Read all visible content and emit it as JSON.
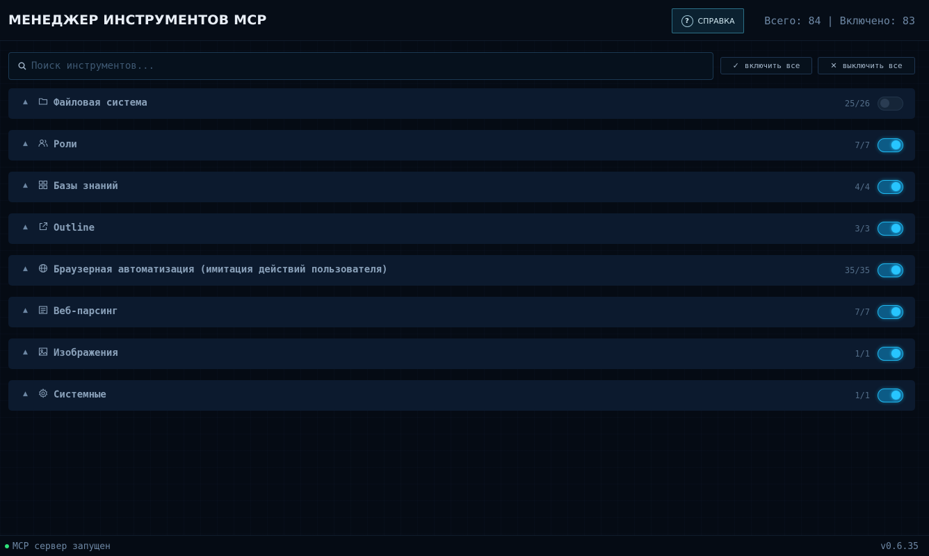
{
  "header": {
    "title": "МЕНЕДЖЕР ИНСТРУМЕНТОВ MCP",
    "help_label": "СПРАВКА",
    "stats": "Всего: 84 | Включено: 83"
  },
  "search": {
    "placeholder": "Поиск инструментов...",
    "value": ""
  },
  "toolbar": {
    "enable_all_label": "включить все",
    "disable_all_label": "выключить все"
  },
  "categories": [
    {
      "label": "Файловая система",
      "count": "25/26",
      "icon": "folder-icon",
      "enabled": false
    },
    {
      "label": "Роли",
      "count": "7/7",
      "icon": "users-icon",
      "enabled": true
    },
    {
      "label": "Базы знаний",
      "count": "4/4",
      "icon": "grid-icon",
      "enabled": true
    },
    {
      "label": "Outline",
      "count": "3/3",
      "icon": "external-link-icon",
      "enabled": true
    },
    {
      "label": "Браузерная автоматизация (имитация действий пользователя)",
      "count": "35/35",
      "icon": "globe-icon",
      "enabled": true
    },
    {
      "label": "Веб-парсинг",
      "count": "7/7",
      "icon": "document-icon",
      "enabled": true
    },
    {
      "label": "Изображения",
      "count": "1/1",
      "icon": "image-icon",
      "enabled": true
    },
    {
      "label": "Системные",
      "count": "1/1",
      "icon": "gear-icon",
      "enabled": true
    }
  ],
  "footer": {
    "status": "MCP сервер запущен",
    "version": "v0.6.35"
  },
  "colors": {
    "accent": "#1fb8f0",
    "status_ok": "#2ee37a",
    "background": "#050b14",
    "panel": "#0c1a2e"
  }
}
